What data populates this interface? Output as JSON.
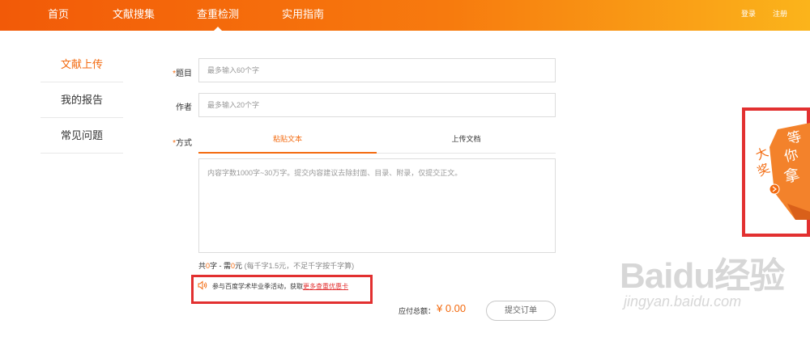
{
  "header": {
    "nav": [
      "首页",
      "文献搜集",
      "查重检测",
      "实用指南"
    ],
    "active_index": 2,
    "login": "登录",
    "register": "注册"
  },
  "sidebar": {
    "items": [
      {
        "label": "文献上传",
        "active": true
      },
      {
        "label": "我的报告",
        "active": false
      },
      {
        "label": "常见问题",
        "active": false
      }
    ]
  },
  "form": {
    "title": {
      "required_mark": "*",
      "label": "题目",
      "placeholder": "最多输入60个字"
    },
    "author": {
      "label": "作者",
      "placeholder": "最多输入20个字"
    },
    "method": {
      "required_mark": "*",
      "label": "方式"
    },
    "tabs": [
      {
        "label": "粘贴文本",
        "active": true
      },
      {
        "label": "上传文档",
        "active": false
      }
    ],
    "textarea_placeholder": "内容字数1000字~30万字。提交内容建议去除封面、目录、附录，仅提交正文。",
    "count": {
      "prefix": "共",
      "chars": "0",
      "mid": "字 - 需",
      "price": "0",
      "suffix": "元",
      "hint": "(每千字1.5元，不足千字按千字算)"
    },
    "promo": {
      "text": "参与百度学术毕业季活动，获取",
      "link": "更多查重优惠卡"
    },
    "total_label": "应付总额：",
    "total_value": "¥ 0.00",
    "submit_label": "提交订单"
  },
  "banner": {
    "text": [
      "等",
      "你",
      "拿",
      "大",
      "奖"
    ]
  },
  "watermark": {
    "main": "Baidu经验",
    "sub": "jingyan.baidu.com"
  },
  "colors": {
    "accent": "#f36a0f",
    "highlight_border": "#e23030",
    "header_start": "#f25a08",
    "header_end": "#fbb41b"
  }
}
